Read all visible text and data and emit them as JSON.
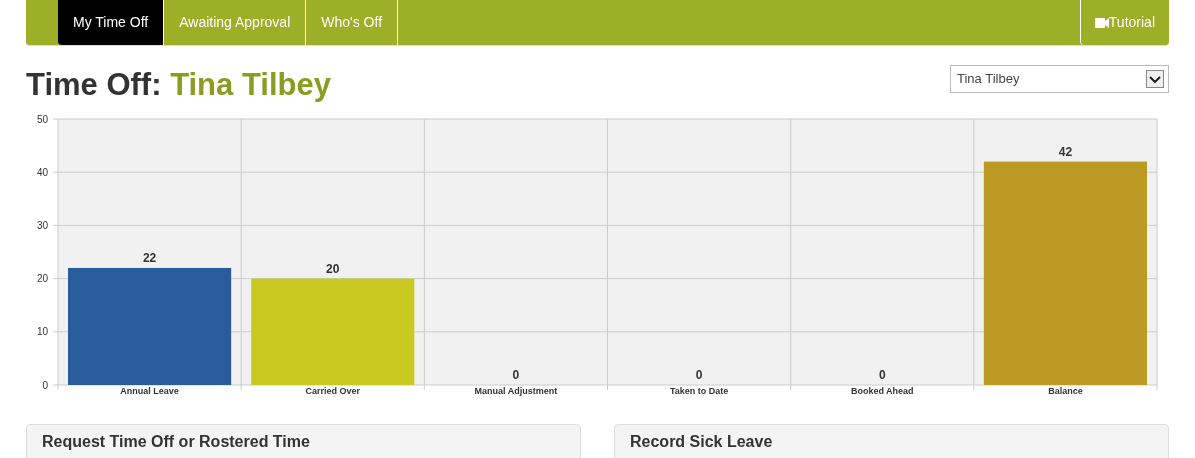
{
  "nav": {
    "tabs": [
      {
        "label": "My Time Off",
        "selected": true
      },
      {
        "label": "Awaiting Approval",
        "selected": false
      },
      {
        "label": "Who's Off",
        "selected": false
      }
    ],
    "tutorial": "Tutorial"
  },
  "heading": {
    "prefix": "Time Off:",
    "name": "Tina Tilbey"
  },
  "employee_select": {
    "value": "Tina Tilbey"
  },
  "chart": {
    "chart_data": {
      "type": "bar",
      "categories": [
        "Annual Leave",
        "Carried Over",
        "Manual Adjustment",
        "Taken to Date",
        "Booked Ahead",
        "Balance"
      ],
      "series": [
        {
          "values": [
            22,
            20,
            0,
            0,
            0,
            42
          ]
        }
      ],
      "colors": [
        "#2a5c9c",
        "#c9c922",
        "#2a5c9c",
        "#2a5c9c",
        "#2a5c9c",
        "#bc9a24"
      ],
      "ylim": [
        0,
        50
      ],
      "grid": true,
      "yticks": [
        0,
        10,
        20,
        30,
        40,
        50
      ],
      "data_labels": true
    }
  },
  "panels": [
    {
      "title": "Request Time Off or Rostered Time"
    },
    {
      "title": "Record Sick Leave"
    }
  ]
}
